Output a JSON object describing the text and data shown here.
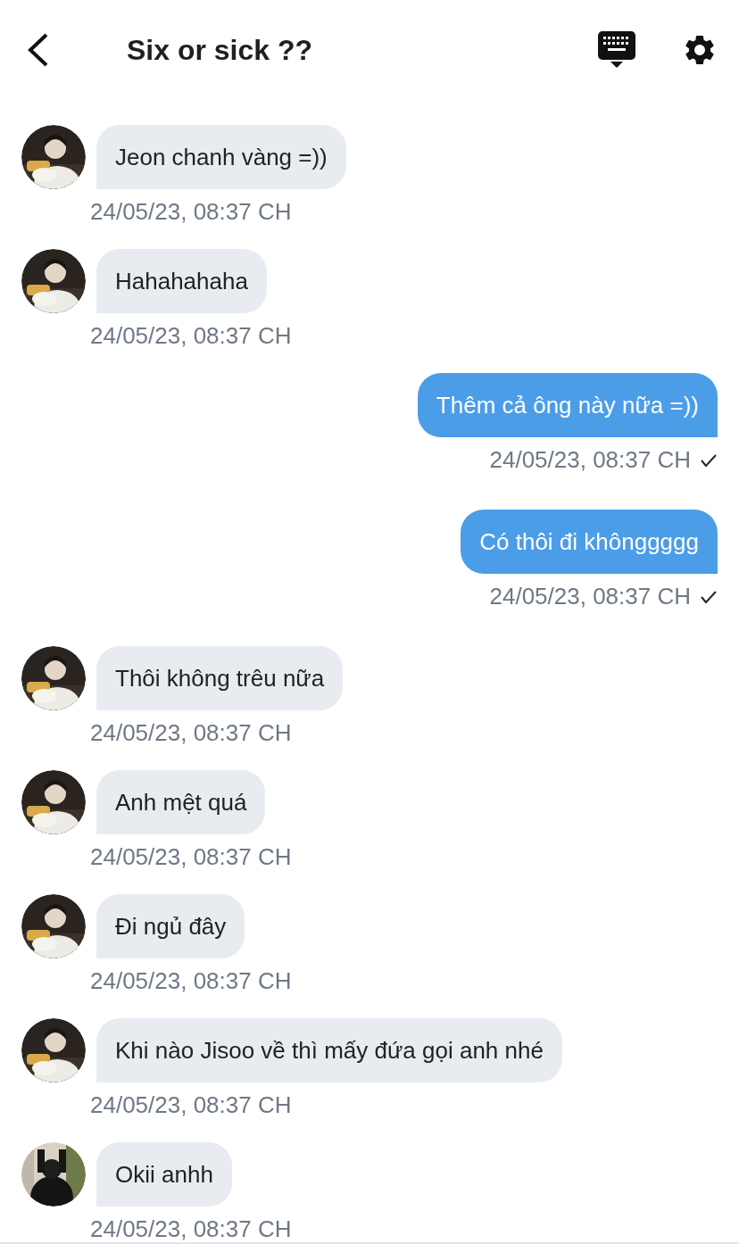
{
  "header": {
    "title": "Six or sick ??"
  },
  "messages": [
    {
      "kind": "incoming",
      "text": "Jeon chanh vàng =))",
      "time": "24/05/23, 08:37 CH"
    },
    {
      "kind": "incoming",
      "text": "Hahahahaha",
      "time": "24/05/23, 08:37 CH"
    },
    {
      "kind": "outgoing",
      "text": "Thêm cả ông này nữa =))",
      "time": "24/05/23, 08:37 CH",
      "delivered": true
    },
    {
      "kind": "outgoing",
      "text": "Có thôi đi khônggggg",
      "time": "24/05/23, 08:37 CH",
      "delivered": true
    },
    {
      "kind": "incoming",
      "text": "Thôi không trêu nữa",
      "time": "24/05/23, 08:37 CH"
    },
    {
      "kind": "incoming",
      "text": "Anh mệt quá",
      "time": "24/05/23, 08:37 CH"
    },
    {
      "kind": "incoming",
      "text": "Đi ngủ đây",
      "time": "24/05/23, 08:37 CH"
    },
    {
      "kind": "incoming",
      "text": "Khi nào Jisoo về thì mấy đứa gọi anh nhé",
      "time": "24/05/23, 08:37 CH"
    },
    {
      "kind": "incoming",
      "text": "Okii anhh",
      "time": "24/05/23, 08:37 CH"
    }
  ]
}
